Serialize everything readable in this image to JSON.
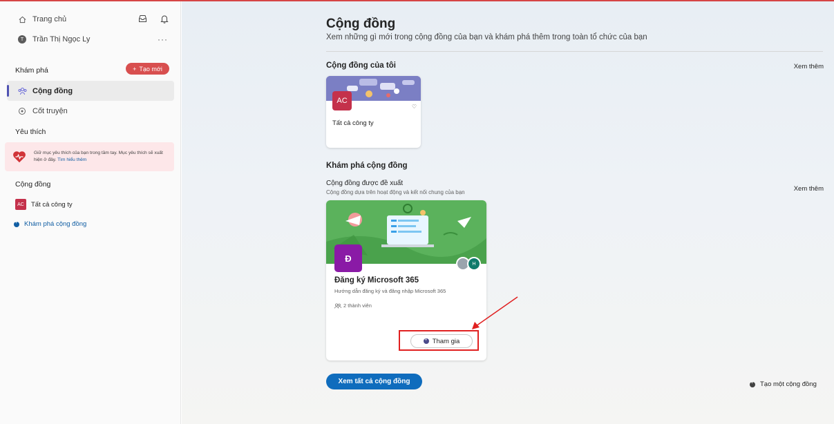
{
  "sidebar": {
    "home_label": "Trang chủ",
    "user_initial": "T",
    "user_name": "Trần Thị Ngọc Ly",
    "more_label": "···",
    "explore_section": "Khám phá",
    "new_button": "Tạo mới",
    "items": [
      {
        "label": "Cộng đồng",
        "active": true,
        "icon": "community-icon"
      },
      {
        "label": "Cốt truyện",
        "active": false,
        "icon": "storyline-icon"
      }
    ],
    "favorites_section": "Yêu thích",
    "favorites_text": "Giữ mục yêu thích của bạn trong tầm tay. Mục yêu thích sẽ xuất hiện ở đây.",
    "favorites_link": "Tìm hiểu thêm",
    "communities_section": "Cộng đồng",
    "community_item": {
      "initials": "AC",
      "label": "Tất cả công ty"
    },
    "explore_link": "Khám phá cộng đồng"
  },
  "main": {
    "title": "Cộng đồng",
    "subtitle": "Xem những gì mới trong cộng đồng của bạn và khám phá thêm trong toàn tổ chức của bạn",
    "my_communities": "Cộng đồng của tôi",
    "see_more": "Xem thêm",
    "my_card": {
      "initials": "AC",
      "name": "Tất cả công ty"
    },
    "explore_heading": "Khám phá cộng đồng",
    "suggested_heading": "Cộng đồng được đề xuất",
    "suggested_sub": "Cộng đồng dựa trên hoạt động và kết nối chung của bạn",
    "suggested_card": {
      "initial": "Đ",
      "name": "Đăng ký Microsoft 365",
      "description": "Hướng dẫn đăng ký và đăng nhập Microsoft 365",
      "members": "2 thành viên",
      "avatar_initial": "H",
      "join_label": "Tham gia"
    },
    "all_button": "Xem tất cả cộng đồng",
    "create_link": "Tạo một cộng đồng"
  },
  "colors": {
    "accent": "#0f6cbd",
    "new_button": "#d84f4f",
    "ac_badge": "#c4314b",
    "d_badge": "#8a1aa6",
    "annotation": "#e02020"
  }
}
